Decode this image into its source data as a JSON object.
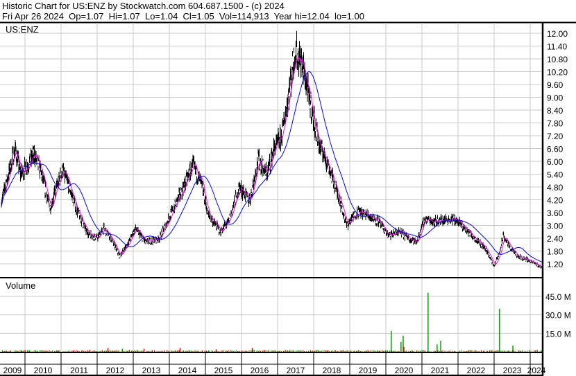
{
  "header": {
    "title": "Historic Chart for US:ENZ by Stockwatch.com 604.687.1500 - (c) 2024",
    "quote": "Fri Apr 26 2024  Op=1.07  Hi=1.07  Lo=1.04  Cl=1.05  Vol=114,913  Year hi=12.04  lo=1.00"
  },
  "chart_data": [
    {
      "type": "line",
      "title": "US:ENZ",
      "ylim": [
        1.0,
        12.3
      ],
      "yticks": [
        "12.00",
        "11.40",
        "10.80",
        "10.20",
        "9.60",
        "9.00",
        "8.40",
        "7.80",
        "7.20",
        "6.60",
        "6.00",
        "5.40",
        "4.80",
        "4.20",
        "3.60",
        "3.00",
        "2.40",
        "1.80",
        "1.20"
      ],
      "series": [
        {
          "name": "price",
          "x": [
            2009.35,
            2009.73,
            2009.88,
            2010.27,
            2010.46,
            2010.69,
            2011.04,
            2011.23,
            2011.42,
            2011.71,
            2012.0,
            2012.19,
            2012.38,
            2012.62,
            2012.87,
            2013.06,
            2013.35,
            2013.73,
            2014.12,
            2014.4,
            2014.65,
            2014.88,
            2015.08,
            2015.42,
            2015.65,
            2015.94,
            2016.23,
            2016.46,
            2016.71,
            2016.9,
            2017.1,
            2017.29,
            2017.48,
            2017.67,
            2017.87,
            2018.15,
            2018.35,
            2018.54,
            2018.73,
            2018.92,
            2019.21,
            2019.5,
            2019.79,
            2020.08,
            2020.37,
            2020.65,
            2020.85,
            2021.08,
            2021.33,
            2021.62,
            2021.9,
            2022.19,
            2022.48,
            2022.77,
            2023.0,
            2023.15,
            2023.25,
            2023.44,
            2023.63,
            2023.92,
            2024.31
          ],
          "values": [
            4.15,
            6.6,
            5.4,
            6.3,
            5.4,
            3.8,
            5.6,
            4.8,
            3.8,
            2.7,
            2.4,
            2.85,
            2.4,
            1.55,
            2.2,
            2.85,
            2.2,
            2.4,
            3.8,
            4.8,
            5.8,
            5.0,
            3.5,
            2.7,
            3.2,
            4.8,
            4.15,
            6.1,
            5.4,
            6.6,
            7.1,
            9.0,
            11.1,
            10.6,
            9.0,
            6.75,
            6.1,
            5.1,
            4.15,
            3.0,
            3.65,
            3.5,
            3.2,
            2.5,
            2.7,
            2.4,
            2.2,
            3.3,
            3.2,
            3.25,
            3.3,
            2.85,
            2.4,
            1.9,
            1.1,
            1.7,
            2.5,
            2.0,
            1.55,
            1.4,
            1.05
          ]
        }
      ]
    },
    {
      "type": "bar",
      "title": "Volume",
      "yticks": [
        "45.0 M",
        "30.0 M",
        "15.0 M"
      ],
      "ylim": [
        0,
        55
      ],
      "series": [
        {
          "name": "volume_spikes_M",
          "x": [
            2009.9,
            2010.9,
            2011.8,
            2012.3,
            2012.7,
            2013.3,
            2014.3,
            2015.3,
            2016.3,
            2020.15,
            2020.42,
            2020.48,
            2020.5,
            2021.17,
            2021.42,
            2021.52,
            2023.15,
            2023.52
          ],
          "values": [
            1,
            1,
            1.5,
            3,
            2.5,
            2.5,
            3,
            2,
            3,
            17,
            8,
            13,
            4,
            48,
            6,
            9,
            35,
            5
          ],
          "colors": [
            "green",
            "green",
            "red",
            "red",
            "green",
            "red",
            "red",
            "red",
            "red",
            "green",
            "green",
            "green",
            "red",
            "green",
            "green",
            "green",
            "green",
            "green"
          ]
        }
      ]
    }
  ],
  "xaxis": {
    "years": [
      "2009",
      "2010",
      "2011",
      "2012",
      "2013",
      "2014",
      "2015",
      "2016",
      "2017",
      "2018",
      "2019",
      "2020",
      "2021",
      "2022",
      "2023",
      "2024"
    ]
  },
  "colors": {
    "price": "#000000",
    "ma_short": "#ff00ff",
    "ma_long": "#0000ff",
    "grid": "#c8c8c8",
    "up": "#00a000",
    "down": "#ff0000"
  }
}
